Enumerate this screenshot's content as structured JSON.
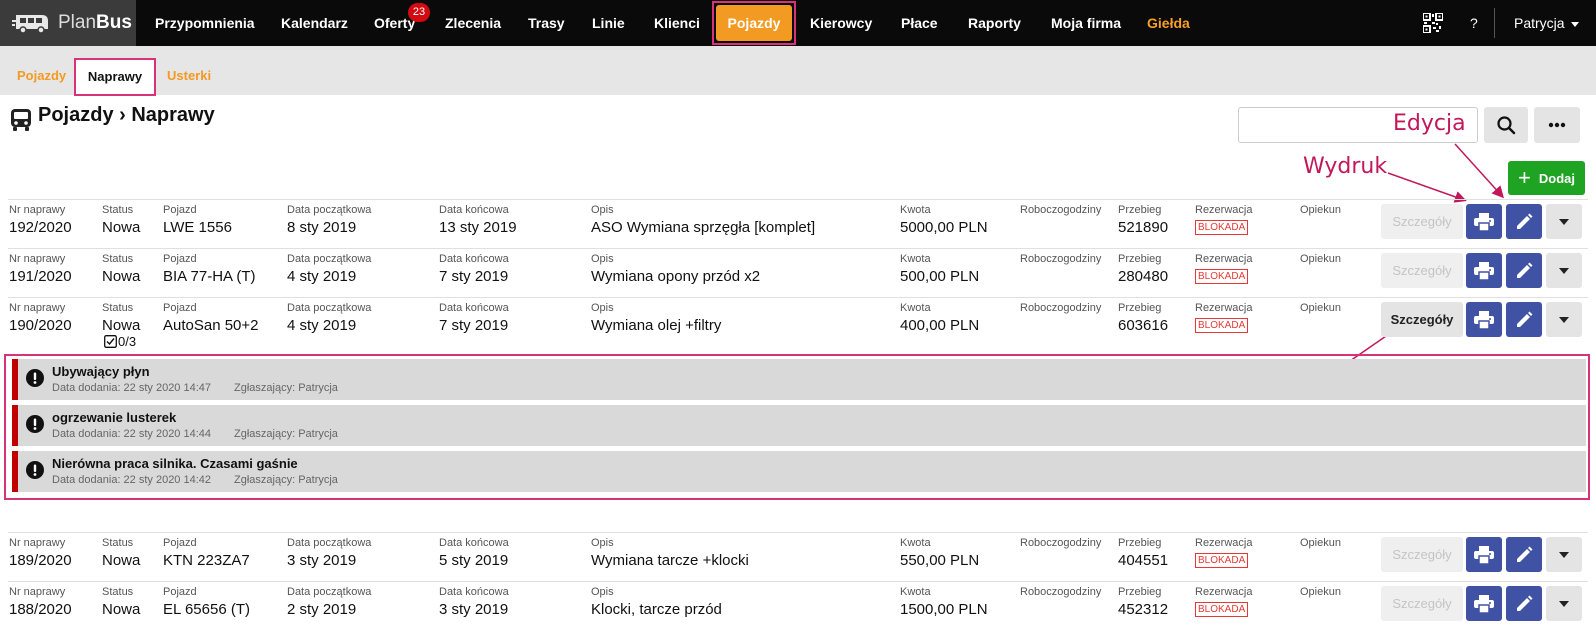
{
  "app": {
    "logo_plan": "Plan",
    "logo_bus": "Bus"
  },
  "nav": {
    "items": [
      "Przypomnienia",
      "Kalendarz",
      "Oferty",
      "Zlecenia",
      "Trasy",
      "Linie",
      "Klienci",
      "Pojazdy",
      "Kierowcy",
      "Płace",
      "Raporty",
      "Moja firma",
      "Giełda"
    ],
    "active": "Pojazdy",
    "badge": "23",
    "help": "?",
    "user": "Patrycja",
    "accent": "#f39a22"
  },
  "subnav": {
    "items": [
      "Pojazdy",
      "Naprawy",
      "Usterki"
    ],
    "active": "Naprawy"
  },
  "page": {
    "title": "Pojazdy › Naprawy",
    "search_placeholder": "",
    "add_label": "Dodaj"
  },
  "annotations": {
    "edit": "Edycja",
    "print": "Wydruk"
  },
  "columns": {
    "nr": "Nr naprawy",
    "status": "Status",
    "vehicle": "Pojazd",
    "start": "Data początkowa",
    "end": "Data końcowa",
    "desc": "Opis",
    "amount": "Kwota",
    "hours": "Roboczogodziny",
    "mileage": "Przebieg",
    "reservation": "Rezerwacja",
    "caretaker": "Opiekun"
  },
  "details_label": "Szczegóły",
  "rows": [
    {
      "nr": "192/2020",
      "status": "Nowa",
      "vehicle": "LWE 1556",
      "start": "8 sty 2019",
      "end": "13 sty 2019",
      "desc": "ASO Wymiana sprzęgła [komplet]",
      "amount": "5000,00 PLN",
      "mileage": "521890",
      "reservation": "BLOKADA"
    },
    {
      "nr": "191/2020",
      "status": "Nowa",
      "vehicle": "BIA 77-HA (T)",
      "start": "4 sty 2019",
      "end": "7 sty 2019",
      "desc": "Wymiana opony przód x2",
      "amount": "500,00 PLN",
      "mileage": "280480",
      "reservation": "BLOKADA"
    },
    {
      "nr": "190/2020",
      "status": "Nowa",
      "vehicle": "AutoSan 50+2",
      "start": "4 sty 2019",
      "end": "7 sty 2019",
      "desc": "Wymiana olej +filtry",
      "amount": "400,00 PLN",
      "mileage": "603616",
      "reservation": "BLOKADA",
      "checklist": "0/3"
    },
    {
      "nr": "189/2020",
      "status": "Nowa",
      "vehicle": "KTN 223ZA7",
      "start": "3 sty 2019",
      "end": "5 sty 2019",
      "desc": "Wymiana tarcze +klocki",
      "amount": "550,00 PLN",
      "mileage": "404551",
      "reservation": "BLOKADA"
    },
    {
      "nr": "188/2020",
      "status": "Nowa",
      "vehicle": "EL 65656 (T)",
      "start": "2 sty 2019",
      "end": "3 sty 2019",
      "desc": "Klocki, tarcze przód",
      "amount": "1500,00 PLN",
      "mileage": "452312",
      "reservation": "BLOKADA"
    }
  ],
  "issues": [
    {
      "title": "Ubywający płyn",
      "date": "Data dodania: 22 sty 2020 14:47",
      "reporter": "Zgłaszający: Patrycja"
    },
    {
      "title": "ogrzewanie lusterek",
      "date": "Data dodania: 22 sty 2020 14:44",
      "reporter": "Zgłaszający: Patrycja"
    },
    {
      "title": "Nierówna praca silnika. Czasami gaśnie",
      "date": "Data dodania: 22 sty 2020 14:42",
      "reporter": "Zgłaszający: Patrycja"
    }
  ]
}
